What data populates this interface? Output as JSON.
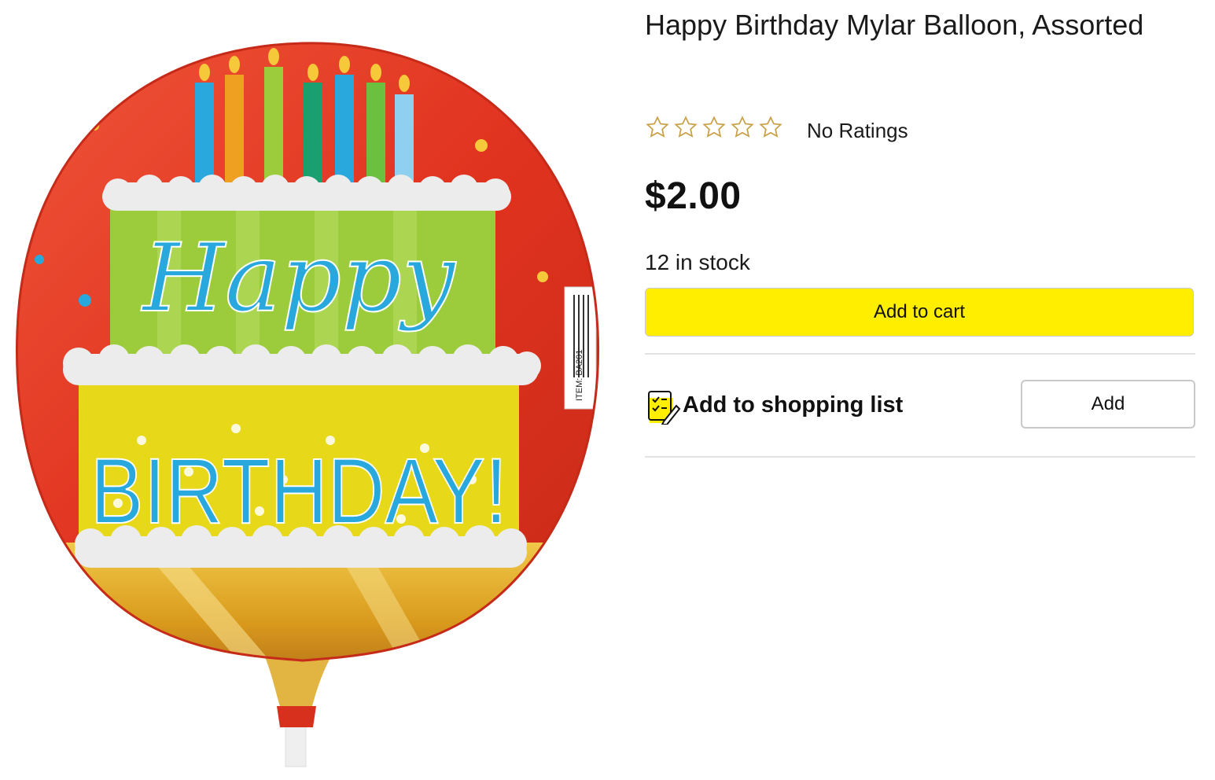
{
  "product": {
    "title": "Happy Birthday Mylar Balloon, Assorted",
    "rating_stars": 0,
    "rating_max": 5,
    "rating_text": "No Ratings",
    "price": "$2.00",
    "stock_text": "12 in stock"
  },
  "image": {
    "balloon_text_line1": "Happy",
    "balloon_text_line2": "BIRTHDAY!",
    "sticker_text": "ITEM: BA201",
    "icon": "happy-birthday-balloon-image"
  },
  "actions": {
    "add_to_cart_label": "Add to cart",
    "shopping_list_label": "Add to shopping list",
    "shopping_list_icon": "checklist-icon",
    "add_label": "Add"
  },
  "colors": {
    "cart_button": "#ffee00",
    "star_outline": "#c8a046",
    "balloon_red": "#e0331f",
    "balloon_green": "#9ccc3c",
    "balloon_yellow": "#e8d81a",
    "balloon_text_blue": "#29a8de"
  }
}
